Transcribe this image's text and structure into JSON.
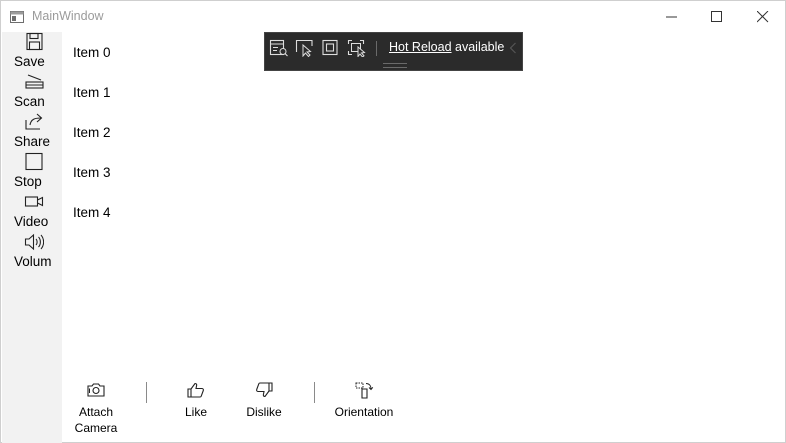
{
  "window": {
    "title": "MainWindow"
  },
  "left_commands": [
    {
      "label": "Save",
      "icon": "save-icon"
    },
    {
      "label": "Scan",
      "icon": "scan-icon"
    },
    {
      "label": "Share",
      "icon": "share-icon"
    },
    {
      "label": "Stop",
      "icon": "stop-icon"
    },
    {
      "label": "Video",
      "icon": "video-icon"
    },
    {
      "label": "Volum",
      "icon": "volume-icon"
    }
  ],
  "list": {
    "items": [
      "Item 0",
      "Item 1",
      "Item 2",
      "Item 3",
      "Item 4"
    ]
  },
  "hot_reload": {
    "link_text": "Hot Reload",
    "status_text": " available"
  },
  "bottom_commands": [
    {
      "label_line1": "Attach",
      "label_line2": "Camera",
      "icon": "attach-camera-icon"
    },
    {
      "label_line1": "Like",
      "icon": "like-icon"
    },
    {
      "label_line1": "Dislike",
      "icon": "dislike-icon"
    },
    {
      "label_line1": "Orientation",
      "icon": "orientation-icon"
    }
  ],
  "colors": {
    "toolbar_bg": "#2b2b2b",
    "sidebar_bg": "#f2f2f2",
    "title_text": "#9b9b9b"
  }
}
